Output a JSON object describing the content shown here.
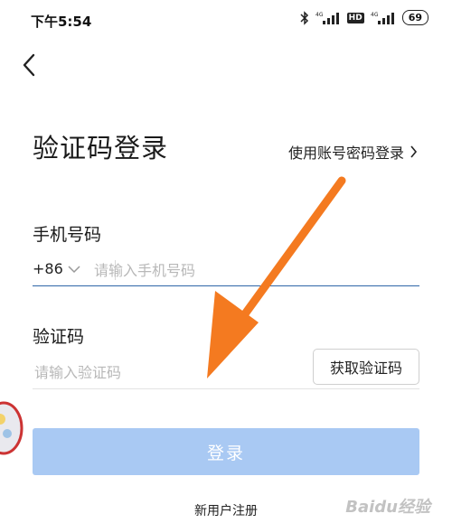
{
  "status_bar": {
    "time": "下午5:54",
    "battery": "69",
    "signal_label_1": "4G",
    "signal_label_2": "4G",
    "hd_badge": "HD"
  },
  "header": {
    "back_icon": "chevron-left-icon"
  },
  "page": {
    "title": "验证码登录",
    "password_login_link": "使用账号密码登录"
  },
  "phone": {
    "label": "手机号码",
    "country_code": "+86",
    "placeholder": "请输入手机号码",
    "value": ""
  },
  "code": {
    "label": "验证码",
    "placeholder": "请输入验证码",
    "value": "",
    "get_code_button": "获取验证码"
  },
  "login_button": "登录",
  "register_link": "新用户注册",
  "colors": {
    "accent_underline": "#2f66a8",
    "login_button_bg": "#a9c9f3",
    "annotation_arrow": "#f47a20"
  },
  "watermark": "Baidu经验"
}
